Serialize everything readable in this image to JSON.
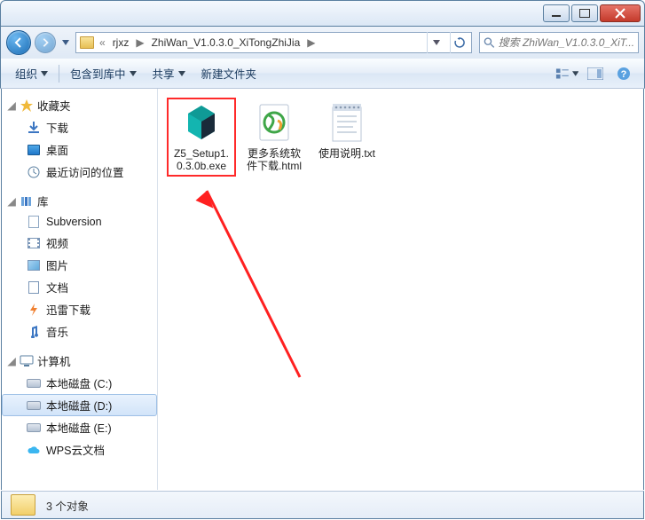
{
  "window": {
    "title": ""
  },
  "breadcrumb": {
    "prefix": "«",
    "seg1": "rjxz",
    "seg2": "ZhiWan_V1.0.3.0_XiTongZhiJia",
    "sep": "▶"
  },
  "search": {
    "placeholder": "搜索 ZhiWan_V1.0.3.0_XiT..."
  },
  "toolbar": {
    "organize": "组织",
    "include": "包含到库中",
    "share": "共享",
    "newfolder": "新建文件夹"
  },
  "sidebar": {
    "favorites": {
      "label": "收藏夹"
    },
    "fav_items": [
      {
        "label": "下载",
        "icon": "download-icon"
      },
      {
        "label": "桌面",
        "icon": "desktop-icon"
      },
      {
        "label": "最近访问的位置",
        "icon": "recent-icon"
      }
    ],
    "library": {
      "label": "库"
    },
    "lib_items": [
      {
        "label": "Subversion",
        "icon": "svn-icon"
      },
      {
        "label": "视频",
        "icon": "video-icon"
      },
      {
        "label": "图片",
        "icon": "picture-icon"
      },
      {
        "label": "文档",
        "icon": "document-icon"
      },
      {
        "label": "迅雷下载",
        "icon": "thunder-icon"
      },
      {
        "label": "音乐",
        "icon": "music-icon"
      }
    ],
    "computer": {
      "label": "计算机"
    },
    "comp_items": [
      {
        "label": "本地磁盘 (C:)",
        "icon": "drive-icon"
      },
      {
        "label": "本地磁盘 (D:)",
        "icon": "drive-icon",
        "selected": true
      },
      {
        "label": "本地磁盘 (E:)",
        "icon": "drive-icon"
      },
      {
        "label": "WPS云文档",
        "icon": "cloud-icon"
      }
    ]
  },
  "files": [
    {
      "label": "Z5_Setup1.0.3.0b.exe",
      "type": "exe",
      "highlight": true
    },
    {
      "label": "更多系统软件下载.html",
      "type": "html"
    },
    {
      "label": "使用说明.txt",
      "type": "txt"
    }
  ],
  "status": {
    "count_text": "3 个对象"
  }
}
